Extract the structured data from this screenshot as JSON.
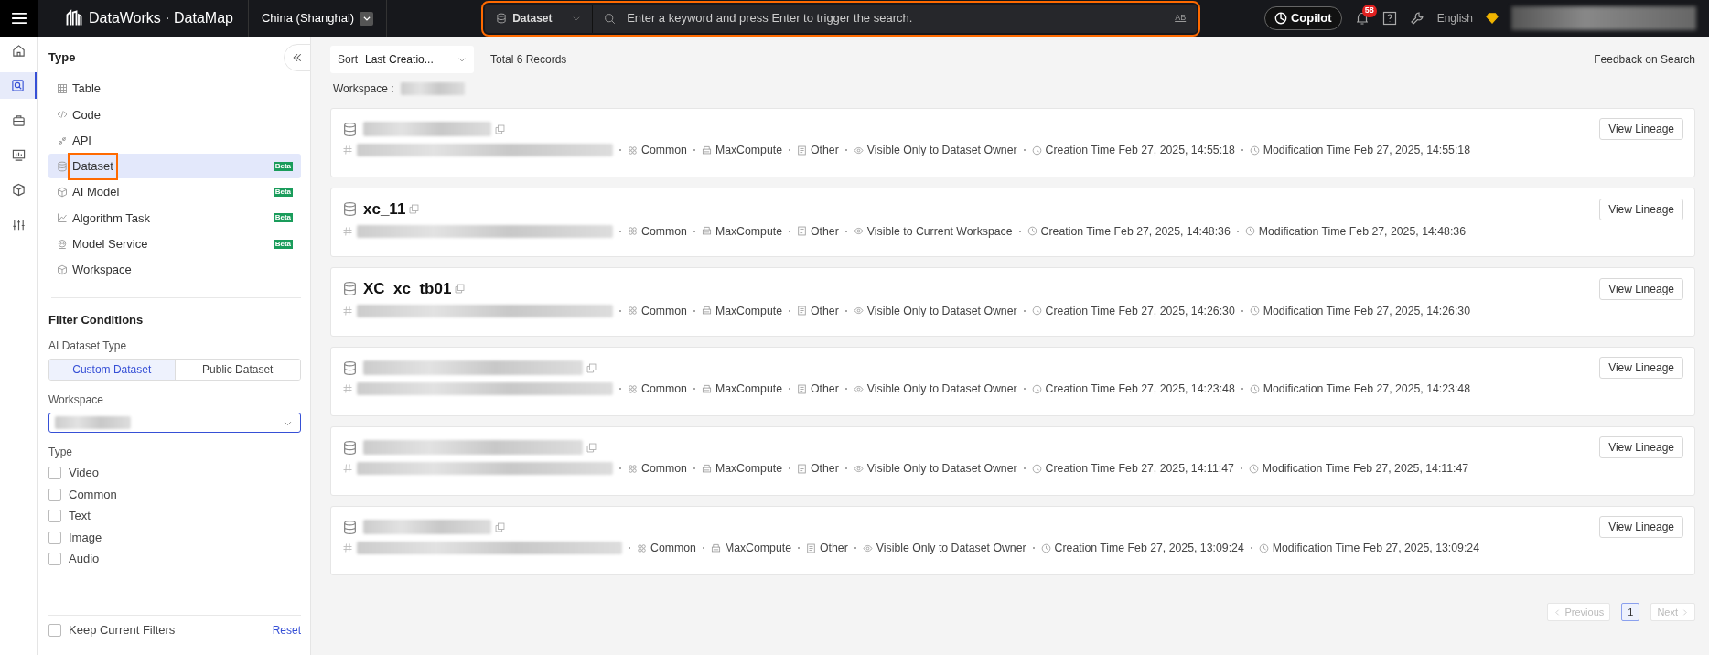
{
  "topbar": {
    "brand": "DataWorks · DataMap",
    "region": "China (Shanghai)",
    "search_scope": "Dataset",
    "search_placeholder": "Enter a keyword and press Enter to trigger the search.",
    "search_highlighted": true,
    "search_toggle": "AB",
    "copilot": "Copilot",
    "notifications": "58",
    "language": "English"
  },
  "rail": [
    {
      "selected": false
    },
    {
      "selected": true
    },
    {
      "selected": false
    },
    {
      "selected": false
    },
    {
      "selected": false
    },
    {
      "selected": false
    }
  ],
  "sidebar": {
    "type_title": "Type",
    "types": [
      {
        "label": "Table",
        "selected": false,
        "highlighted": false
      },
      {
        "label": "Code",
        "selected": false,
        "highlighted": false
      },
      {
        "label": "API",
        "selected": false,
        "highlighted": false
      },
      {
        "label": "Dataset",
        "badge": "Beta",
        "selected": true,
        "highlighted": true
      },
      {
        "label": "AI Model",
        "badge": "Beta",
        "selected": false,
        "highlighted": false
      },
      {
        "label": "Algorithm Task",
        "badge": "Beta",
        "selected": false,
        "highlighted": false
      },
      {
        "label": "Model Service",
        "badge": "Beta",
        "selected": false,
        "highlighted": false
      },
      {
        "label": "Workspace",
        "selected": false,
        "highlighted": false
      }
    ],
    "filter_title": "Filter Conditions",
    "dataset_type_label": "AI Dataset Type",
    "dataset_types": [
      {
        "label": "Custom Dataset",
        "selected": true
      },
      {
        "label": "Public Dataset",
        "selected": false
      }
    ],
    "workspace_label": "Workspace",
    "type_label": "Type",
    "type_filters": [
      {
        "label": "Video",
        "checked": false
      },
      {
        "label": "Common",
        "checked": false
      },
      {
        "label": "Text",
        "checked": false
      },
      {
        "label": "Image",
        "checked": false
      },
      {
        "label": "Audio",
        "checked": false
      }
    ],
    "keep_filters": {
      "label": "Keep Current Filters",
      "checked": false
    },
    "reset": "Reset"
  },
  "results": {
    "sort_label": "Sort",
    "sort_value": "Last Creatio...",
    "total": "Total 6 Records",
    "feedback": "Feedback on Search",
    "workspace_label": "Workspace :",
    "items": [
      {
        "name_hidden": true,
        "action": "View Lineage",
        "meta": [
          {
            "kind": "category",
            "text": "Common"
          },
          {
            "kind": "engine",
            "text": "MaxCompute"
          },
          {
            "kind": "source",
            "text": "Other"
          },
          {
            "kind": "visibility",
            "text": "Visible Only to Dataset Owner"
          },
          {
            "kind": "time",
            "text": "Creation Time Feb 27, 2025, 14:55:18"
          },
          {
            "kind": "time",
            "text": "Modification Time Feb 27, 2025, 14:55:18"
          }
        ]
      },
      {
        "name_hidden": false,
        "name": "xc_11",
        "action": "View Lineage",
        "meta": [
          {
            "kind": "category",
            "text": "Common"
          },
          {
            "kind": "engine",
            "text": "MaxCompute"
          },
          {
            "kind": "source",
            "text": "Other"
          },
          {
            "kind": "visibility",
            "text": "Visible to Current Workspace"
          },
          {
            "kind": "time",
            "text": "Creation Time Feb 27, 2025, 14:48:36"
          },
          {
            "kind": "time",
            "text": "Modification Time Feb 27, 2025, 14:48:36"
          }
        ]
      },
      {
        "name_hidden": false,
        "name": "XC_xc_tb01",
        "action": "View Lineage",
        "meta": [
          {
            "kind": "category",
            "text": "Common"
          },
          {
            "kind": "engine",
            "text": "MaxCompute"
          },
          {
            "kind": "source",
            "text": "Other"
          },
          {
            "kind": "visibility",
            "text": "Visible Only to Dataset Owner"
          },
          {
            "kind": "time",
            "text": "Creation Time Feb 27, 2025, 14:26:30"
          },
          {
            "kind": "time",
            "text": "Modification Time Feb 27, 2025, 14:26:30"
          }
        ]
      },
      {
        "name_hidden": true,
        "action": "View Lineage",
        "meta": [
          {
            "kind": "category",
            "text": "Common"
          },
          {
            "kind": "engine",
            "text": "MaxCompute"
          },
          {
            "kind": "source",
            "text": "Other"
          },
          {
            "kind": "visibility",
            "text": "Visible Only to Dataset Owner"
          },
          {
            "kind": "time",
            "text": "Creation Time Feb 27, 2025, 14:23:48"
          },
          {
            "kind": "time",
            "text": "Modification Time Feb 27, 2025, 14:23:48"
          }
        ]
      },
      {
        "name_hidden": true,
        "action": "View Lineage",
        "meta": [
          {
            "kind": "category",
            "text": "Common"
          },
          {
            "kind": "engine",
            "text": "MaxCompute"
          },
          {
            "kind": "source",
            "text": "Other"
          },
          {
            "kind": "visibility",
            "text": "Visible Only to Dataset Owner"
          },
          {
            "kind": "time",
            "text": "Creation Time Feb 27, 2025, 14:11:47"
          },
          {
            "kind": "time",
            "text": "Modification Time Feb 27, 2025, 14:11:47"
          }
        ]
      },
      {
        "name_hidden": true,
        "action": "View Lineage",
        "meta": [
          {
            "kind": "category",
            "text": "Common"
          },
          {
            "kind": "engine",
            "text": "MaxCompute"
          },
          {
            "kind": "source",
            "text": "Other"
          },
          {
            "kind": "visibility",
            "text": "Visible Only to Dataset Owner"
          },
          {
            "kind": "time",
            "text": "Creation Time Feb 27, 2025, 13:09:24"
          },
          {
            "kind": "time",
            "text": "Modification Time Feb 27, 2025, 13:09:24"
          }
        ]
      }
    ],
    "pagination": [
      {
        "kind": "prev",
        "label": "Previous",
        "disabled": true,
        "selected": false
      },
      {
        "kind": "page",
        "label": "1",
        "disabled": false,
        "selected": true
      },
      {
        "kind": "next",
        "label": "Next",
        "disabled": true,
        "selected": false
      }
    ]
  }
}
